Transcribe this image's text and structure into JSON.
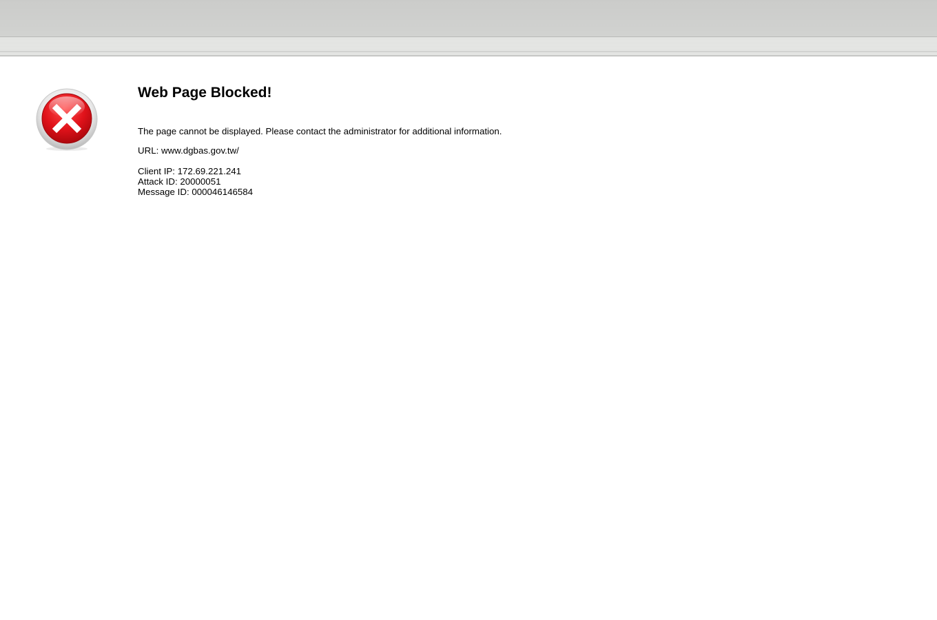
{
  "page": {
    "title": "Web Page Blocked!",
    "message": "The page cannot be displayed. Please contact the administrator for additional information.",
    "url_line": "URL: www.dgbas.gov.tw/",
    "client_ip_line": "Client IP: 172.69.221.241",
    "attack_id_line": "Attack ID: 20000051",
    "message_id_line": "Message ID: 000046146584"
  },
  "icon": {
    "name": "error-x-icon",
    "color": "#d40c14"
  }
}
